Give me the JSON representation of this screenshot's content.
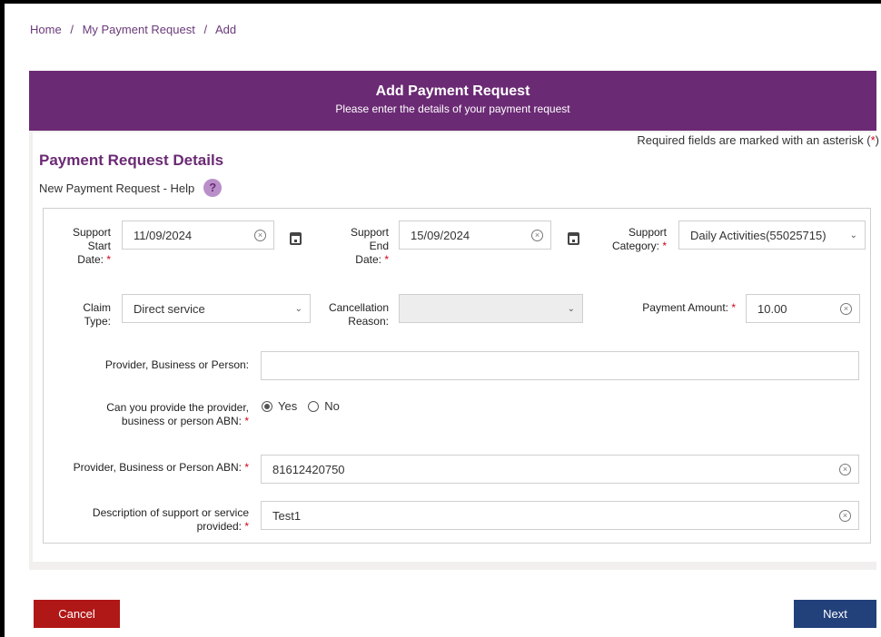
{
  "breadcrumb": [
    "Home",
    "My Payment Request",
    "Add"
  ],
  "breadcrumb_sep": "/",
  "header": {
    "title": "Add Payment Request",
    "subtitle": "Please enter the details of your payment request"
  },
  "required_note": {
    "text": "Required fields are marked with an asterisk (",
    "asterisk": "*",
    "close": ")"
  },
  "section": {
    "title": "Payment Request Details",
    "help_text": "New Payment Request - Help",
    "help_icon": "?"
  },
  "fields": {
    "start_date": {
      "label_1": "Support",
      "label_2": "Start",
      "label_3": "Date:",
      "value": "11/09/2024"
    },
    "end_date": {
      "label_1": "Support",
      "label_2": "End",
      "label_3": "Date:",
      "value": "15/09/2024"
    },
    "category": {
      "label_1": "Support",
      "label_2": "Category:",
      "value": "Daily Activities(55025715)"
    },
    "claim_type": {
      "label_1": "Claim",
      "label_2": "Type:",
      "value": "Direct service"
    },
    "cancellation": {
      "label_1": "Cancellation",
      "label_2": "Reason:",
      "value": ""
    },
    "payment_amount": {
      "label": "Payment Amount:",
      "value": "10.00"
    },
    "provider": {
      "label": "Provider, Business or Person:",
      "value": ""
    },
    "abn_question": {
      "label_1": "Can you provide the provider,",
      "label_2": "business or person ABN:",
      "yes": "Yes",
      "no": "No",
      "selected": "Yes"
    },
    "abn": {
      "label": "Provider, Business or Person ABN:",
      "value": "81612420750"
    },
    "description": {
      "label_1": "Description of support or service",
      "label_2": "provided:",
      "value": "Test1"
    }
  },
  "asterisk": "*",
  "buttons": {
    "cancel": "Cancel",
    "next": "Next"
  },
  "colors": {
    "brand_purple": "#6b2a74",
    "cancel_red": "#b01717",
    "next_navy": "#22407a",
    "required_red": "#d0021b"
  }
}
